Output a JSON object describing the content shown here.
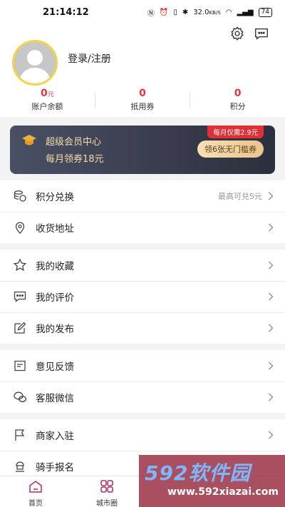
{
  "status_bar": {
    "time": "21:14:12",
    "net_speed": "32.0",
    "net_unit": "KB/S",
    "battery": "74"
  },
  "profile": {
    "login_label": "登录/注册"
  },
  "stats": [
    {
      "value": "0",
      "unit": "元",
      "label": "账户余额"
    },
    {
      "value": "0",
      "unit": "",
      "label": "抵用券"
    },
    {
      "value": "0",
      "unit": "",
      "label": "积分"
    }
  ],
  "vip": {
    "title": "超级会员中心",
    "subtitle": "每月领券18元",
    "badge": "每月仅需2.9元",
    "button": "领6张无门槛券"
  },
  "menu": {
    "points": {
      "label": "积分兑换",
      "extra": "最高可兑5元"
    },
    "address": {
      "label": "收货地址"
    },
    "favorites": {
      "label": "我的收藏"
    },
    "reviews": {
      "label": "我的评价"
    },
    "posts": {
      "label": "我的发布"
    },
    "feedback": {
      "label": "意见反馈"
    },
    "wechat": {
      "label": "客服微信"
    },
    "merchant": {
      "label": "商家入驻"
    },
    "rider": {
      "label": "骑手报名"
    }
  },
  "tabs": {
    "home": "首页",
    "city": "城市圈"
  },
  "watermark": {
    "brand": "592软件园",
    "url": "www.592xiazai.com"
  },
  "colors": {
    "accent": "#e03547",
    "vip_gold": "#f6dca8",
    "avatar_ring": "#f2d34c"
  }
}
